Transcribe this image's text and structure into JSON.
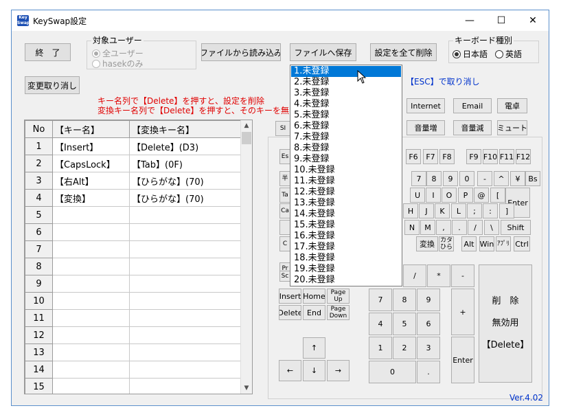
{
  "window": {
    "title": "KeySwap設定",
    "min": "—",
    "max": "☐",
    "close": "✕",
    "icon_label": "Key Swap"
  },
  "buttons": {
    "exit": "終　了",
    "load_file": "ファイルから読み込み",
    "save_file": "ファイルへ保存",
    "delete_all": "設定を全て削除",
    "undo": "変更取り消し"
  },
  "target_user": {
    "title": "対象ユーザー",
    "options": [
      "全ユーザー",
      "hasekのみ"
    ]
  },
  "keyboard_type": {
    "title": "キーボード種別",
    "options": [
      "日本語",
      "英語"
    ]
  },
  "hints": {
    "line1": "キー名列で【Delete】を押すと、設定を削除",
    "line2": "変換キー名列で【Delete】を押すと、そのキーを無",
    "esc": "【ESC】で取り消し"
  },
  "table": {
    "headers": [
      "No",
      "【キー名】",
      "【変換キー名】"
    ],
    "rows": [
      [
        "1",
        "【Insert】",
        "【Delete】(D3)"
      ],
      [
        "2",
        "【CapsLock】",
        "【Tab】(0F)"
      ],
      [
        "3",
        "【右Alt】",
        "【ひらがな】(70)"
      ],
      [
        "4",
        "【変換】",
        "【ひらがな】(70)"
      ],
      [
        "5",
        "",
        ""
      ],
      [
        "6",
        "",
        ""
      ],
      [
        "7",
        "",
        ""
      ],
      [
        "8",
        "",
        ""
      ],
      [
        "9",
        "",
        ""
      ],
      [
        "10",
        "",
        ""
      ],
      [
        "11",
        "",
        ""
      ],
      [
        "12",
        "",
        ""
      ],
      [
        "13",
        "",
        ""
      ],
      [
        "14",
        "",
        ""
      ],
      [
        "15",
        "",
        ""
      ]
    ]
  },
  "dropdown": {
    "items": [
      "1.未登録",
      "2.未登録",
      "3.未登録",
      "4.未登録",
      "5.未登録",
      "6.未登録",
      "7.未登録",
      "8.未登録",
      "9.未登録",
      "10.未登録",
      "11.未登録",
      "12.未登録",
      "13.未登録",
      "14.未登録",
      "15.未登録",
      "16.未登録",
      "17.未登録",
      "18.未登録",
      "19.未登録",
      "20.未登録"
    ],
    "selected_index": 0
  },
  "keys": {
    "media": [
      "Internet",
      "Email",
      "電卓",
      "音量増",
      "音量減",
      "ミュート"
    ],
    "partial_left": [
      "SI",
      "Es",
      "半",
      "Ta",
      "Ca",
      "",
      "C",
      "Pr",
      "Sc"
    ],
    "fn": [
      "F6",
      "F7",
      "F8",
      "F9",
      "F10",
      "F11",
      "F12"
    ],
    "row1": [
      "7",
      "8",
      "9",
      "0",
      "-",
      "^",
      "¥",
      "Bs"
    ],
    "row2": [
      "U",
      "I",
      "O",
      "P",
      "@",
      "[",
      "Enter"
    ],
    "row3": [
      "H",
      "J",
      "K",
      "L",
      ";",
      ":",
      "]"
    ],
    "row4": [
      "N",
      "M",
      ",",
      ".",
      "/",
      "\\",
      "Shift"
    ],
    "row5": [
      "変換",
      "カタ\nひら",
      "Alt",
      "Win",
      "ｱﾌﾟﾘ",
      "Ctrl"
    ],
    "nav": [
      "Insert",
      "Home",
      "Page\nUp",
      "Delete",
      "End",
      "Page\nDown"
    ],
    "arrows": [
      "↑",
      "←",
      "↓",
      "→"
    ],
    "numpad": [
      "/",
      "*",
      "-",
      "7",
      "8",
      "9",
      "+",
      "4",
      "5",
      "6",
      "1",
      "2",
      "3",
      "Enter",
      "0",
      "."
    ],
    "delete_key": {
      "l1": "削　除",
      "l2": "無効用",
      "l3": "【Delete】"
    }
  },
  "version": "Ver.4.02"
}
